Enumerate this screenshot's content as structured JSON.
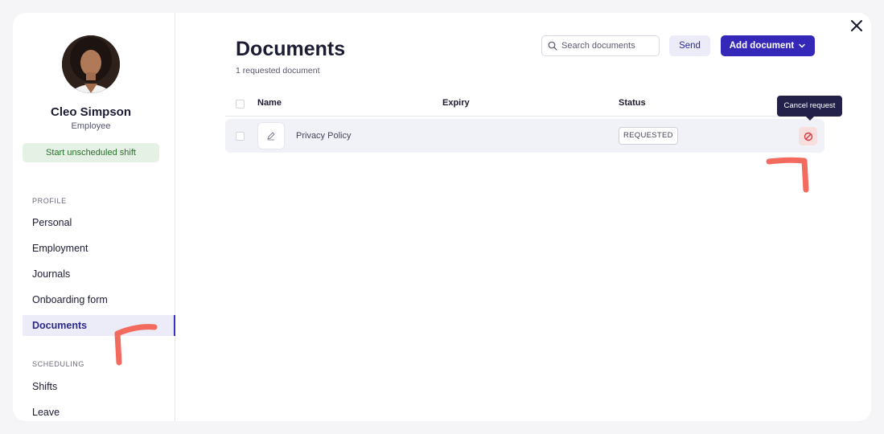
{
  "employee": {
    "name": "Cleo Simpson",
    "role": "Employee",
    "shift_button": "Start unscheduled shift"
  },
  "sidebar": {
    "profile_section": "PROFILE",
    "profile_items": [
      {
        "label": "Personal"
      },
      {
        "label": "Employment"
      },
      {
        "label": "Journals"
      },
      {
        "label": "Onboarding form"
      },
      {
        "label": "Documents"
      }
    ],
    "active_item": "Documents",
    "scheduling_section": "SCHEDULING",
    "scheduling_items": [
      {
        "label": "Shifts"
      },
      {
        "label": "Leave"
      }
    ]
  },
  "main": {
    "title": "Documents",
    "subtitle": "1 requested document",
    "search_placeholder": "Search documents",
    "send_label": "Send",
    "add_label": "Add document",
    "columns": [
      "Name",
      "Expiry",
      "Status"
    ],
    "rows": [
      {
        "name": "Privacy Policy",
        "expiry": "",
        "status": "REQUESTED",
        "icon": "signature-icon"
      }
    ],
    "tooltip": "Cancel request"
  },
  "colors": {
    "accent": "#3528b8",
    "active_nav_bg": "#ecebf8",
    "shift_button_bg": "#e4f1e4",
    "danger": "#d33a3a",
    "annotation": "#f36b5f"
  },
  "icons": [
    "close-icon",
    "search-icon",
    "chevron-down-icon",
    "signature-icon",
    "cancel-circle-icon"
  ]
}
